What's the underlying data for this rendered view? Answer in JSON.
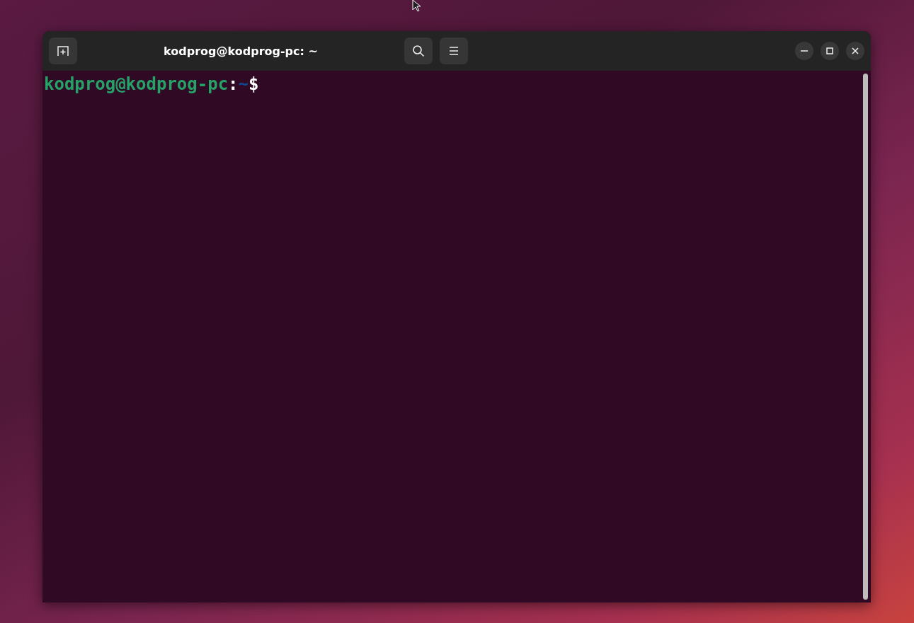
{
  "window": {
    "title": "kodprog@kodprog-pc: ~"
  },
  "terminal": {
    "prompt": {
      "user_host": "kodprog@kodprog-pc",
      "separator": ":",
      "path": "~",
      "symbol": "$"
    }
  }
}
